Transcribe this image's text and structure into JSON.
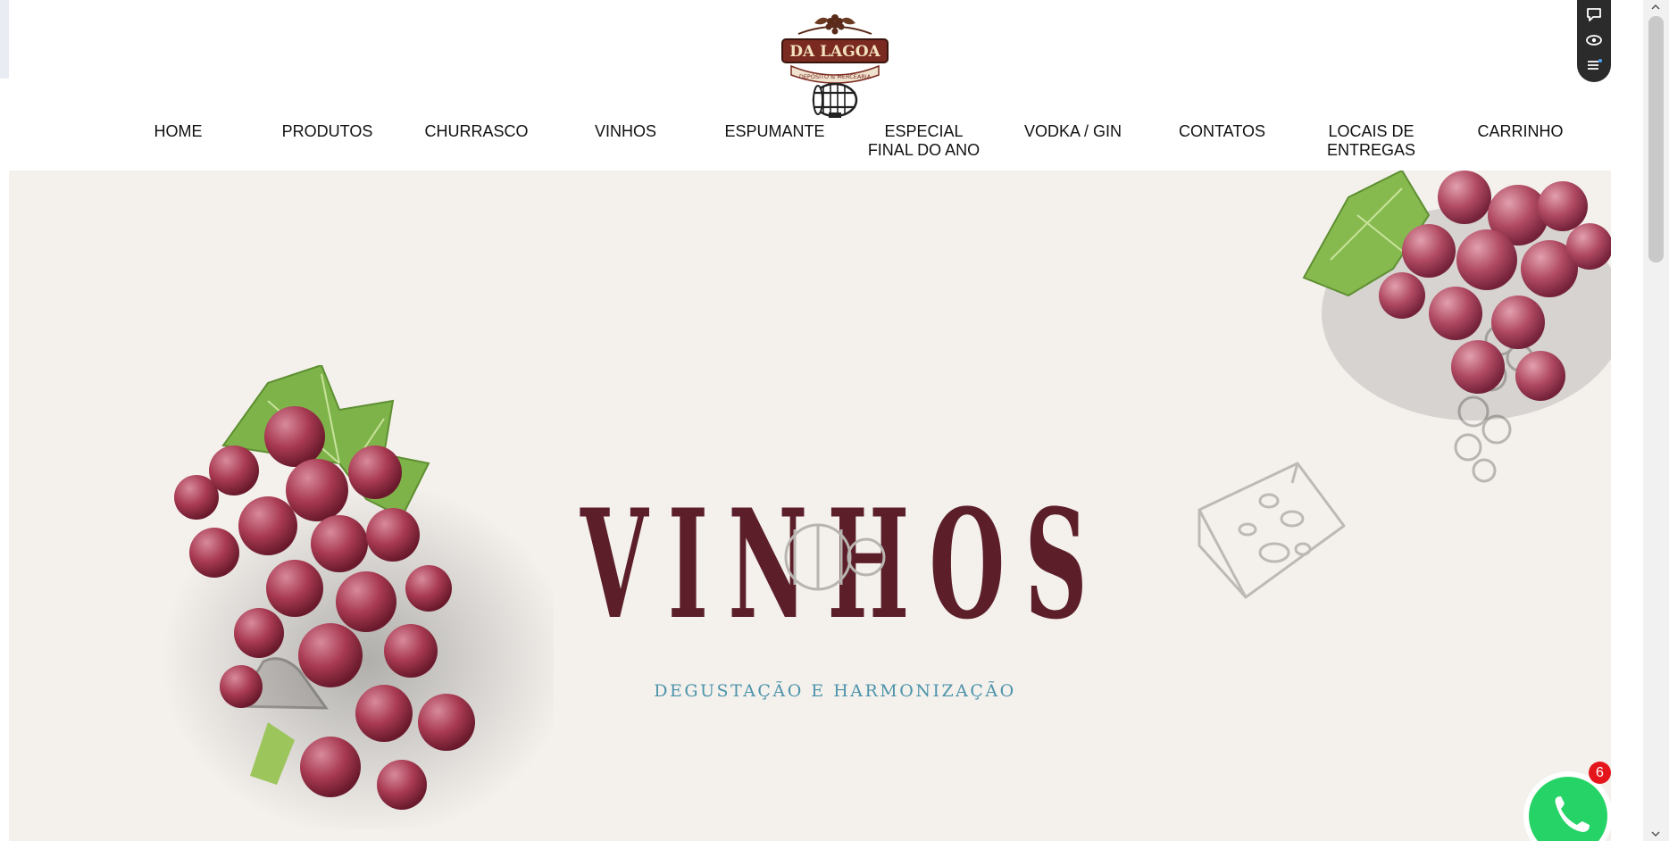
{
  "brand": {
    "name": "DA LAGOA",
    "tagline": "DEPÓSITO & MERCEARIA",
    "colors": {
      "banner": "#7a2a20",
      "accent": "#5c1f2a"
    }
  },
  "nav": {
    "items": [
      {
        "label": "HOME"
      },
      {
        "label": "PRODUTOS"
      },
      {
        "label": "CHURRASCO"
      },
      {
        "label": "VINHOS"
      },
      {
        "label": "ESPUMANTE"
      },
      {
        "label": "ESPECIAL\nFINAL DO ANO"
      },
      {
        "label": "VODKA / GIN"
      },
      {
        "label": "CONTATOS"
      },
      {
        "label": "LOCAIS DE\nENTREGAS"
      },
      {
        "label": "CARRINHO"
      }
    ]
  },
  "hero": {
    "title": "VINHOS",
    "subtitle": "DEGUSTAÇÃO E HARMONIZAÇÃO",
    "colors": {
      "background": "#f4f1ed",
      "title": "#5c1f2a",
      "subtitle": "#4d93aa"
    }
  },
  "side_tools": {
    "icons": [
      "chat-bubble-icon",
      "eye-icon",
      "list-icon"
    ]
  },
  "whatsapp": {
    "icon": "whatsapp-icon",
    "badge_count": "6",
    "colors": {
      "button": "#25d366",
      "badge": "#e4161b"
    }
  }
}
